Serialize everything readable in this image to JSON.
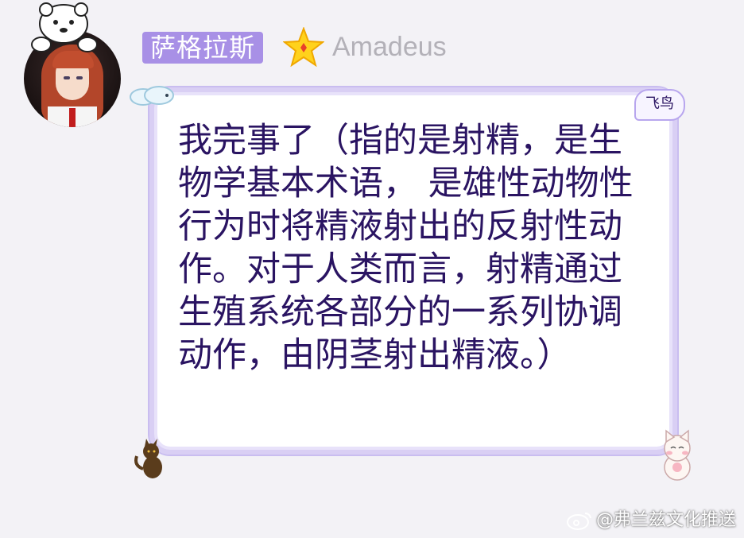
{
  "user": {
    "name": "萨格拉斯",
    "title": "Amadeus",
    "name_badge_color": "#a890e6"
  },
  "message": {
    "tag": "飞鸟",
    "text": "我完事了（指的是射精，是生物学基本术语， 是雄性动物性行为时将精液射出的反射性动作。对于人类而言，射精通过生殖系统各部分的一系列协调动作，由阴茎射出精液。）"
  },
  "icons": {
    "star": "star-icon",
    "avatar_deco": "polar-bear-icon",
    "bubble_deco": "cloud-icon",
    "cat_left": "black-cat-icon",
    "cat_right": "white-cat-icon",
    "watermark": "weibo-icon"
  },
  "watermark": {
    "text": "@弗兰兹文化推送"
  },
  "colors": {
    "text": "#2a1462",
    "bubble_border": "#c9bdf0",
    "background": "#f3f2f6"
  }
}
